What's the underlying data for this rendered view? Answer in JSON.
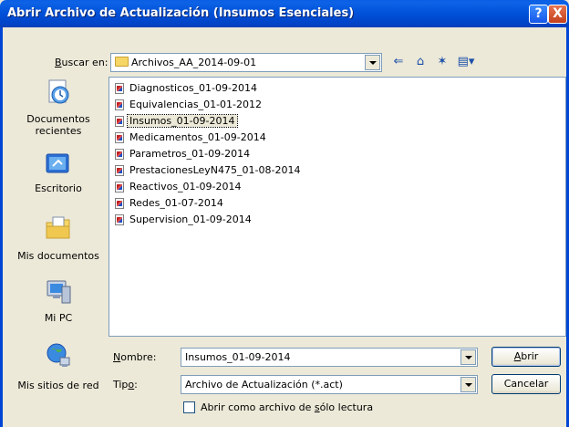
{
  "window": {
    "title": "Abrir Archivo de Actualización (Insumos Esenciales)",
    "help_label": "?",
    "close_label": "X"
  },
  "lookin": {
    "label_u": "B",
    "label_rest": "uscar en:",
    "value": "Archivos_AA_2014-09-01"
  },
  "toolbar": {
    "back_glyph": "⇐",
    "up_glyph": "⌂",
    "newfolder_glyph": "✶",
    "views_glyph": "▤▾"
  },
  "places": [
    {
      "label": "Documentos recientes"
    },
    {
      "label": "Escritorio"
    },
    {
      "label": "Mis documentos"
    },
    {
      "label": "Mi PC"
    },
    {
      "label": "Mis sitios de red"
    }
  ],
  "files": [
    "Diagnosticos_01-09-2014",
    "Equivalencias_01-01-2012",
    "Insumos_01-09-2014",
    "Medicamentos_01-09-2014",
    "Parametros_01-09-2014",
    "PrestacionesLeyN475_01-08-2014",
    "Reactivos_01-09-2014",
    "Redes_01-07-2014",
    "Supervision_01-09-2014"
  ],
  "selected_file": "Insumos_01-09-2014",
  "filename": {
    "label_u": "N",
    "label_rest": "ombre:",
    "value": "Insumos_01-09-2014"
  },
  "filetype": {
    "label_pre": "Tip",
    "label_u": "o",
    "label_rest": ":",
    "value": "Archivo de Actualización (*.act)"
  },
  "readonly": {
    "label_pre": "Abrir como archivo de ",
    "label_u": "s",
    "label_rest": "ólo lectura",
    "checked": false
  },
  "buttons": {
    "open_u": "A",
    "open_rest": "brir",
    "cancel": "Cancelar"
  }
}
